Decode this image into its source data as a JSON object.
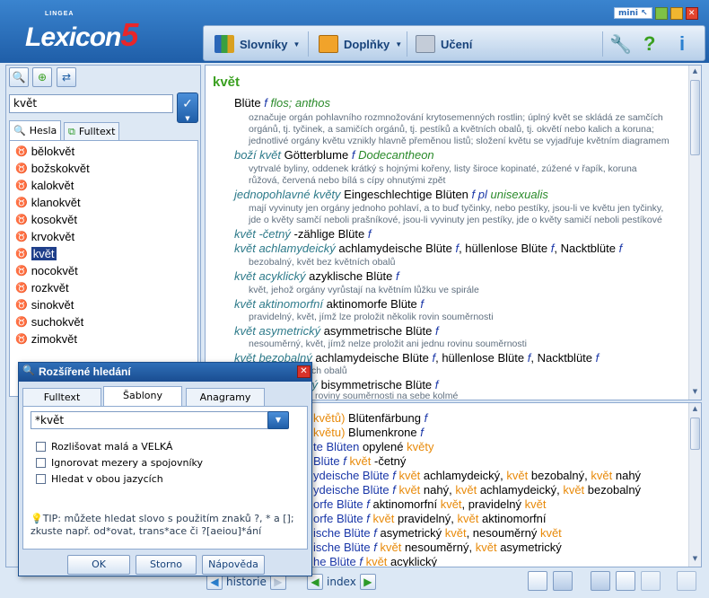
{
  "app": {
    "logo_brand": "Lexicon",
    "logo_version": "5",
    "logo_sup": "LINGEA",
    "mini_label": "mini"
  },
  "toolbar": {
    "dictionaries": "Slovníky",
    "addons": "Doplňky",
    "learning": "Učení"
  },
  "search": {
    "value": "květ"
  },
  "left_tabs": {
    "entries": "Hesla",
    "fulltext": "Fulltext"
  },
  "wordlist": [
    "bělokvět",
    "božskokvět",
    "kalokvět",
    "klanokvět",
    "kosokvět",
    "krvokvět",
    "květ",
    "nocokvět",
    "rozkvět",
    "sinokvět",
    "suchokvět",
    "zimokvět"
  ],
  "entry": {
    "headword": "květ",
    "l1": {
      "de": "Blüte",
      "g": "f",
      "lat": "flos; anthos"
    },
    "l1g": "označuje orgán pohlavního rozmnožování krytosemenných rostlin; úplný květ se skládá ze samčích",
    "l1g2": "orgánů, tj. tyčinek, a samičích orgánů, tj. pestíků a květních obalů, tj. okvětí nebo kalich a koruna;",
    "l1g3": "jednotlivé orgány květu vznikly hlavně přeměnou listů; složení květu se vyjadřuje květním diagramem",
    "l2": {
      "cz": "boží květ",
      "de": "Götterblume",
      "g": "f",
      "lat": "Dodecantheon"
    },
    "l2g": "vytrvalé byliny, oddenek krátký s hojnými kořeny, listy široce kopinaté, zúžené v řapík, koruna",
    "l2g2": "růžová, červená nebo bílá s cípy ohnutými zpět",
    "l3": {
      "cz": "jednopohlavné květy",
      "de": "Eingeschlechtige Blüten",
      "g": "f pl",
      "lat": "unisexualis"
    },
    "l3g": "mají vyvinuty jen orgány jednoho pohlaví, a to buď tyčinky, nebo pestíky, jsou-li ve květu jen tyčinky,",
    "l3g2": "jde o květy samčí neboli prašníkové, jsou-li vyvinuty jen pestíky, jde o květy samičí neboli pestíkové",
    "l4": {
      "cz": "květ -četný",
      "de": "-zählige Blüte",
      "g": "f"
    },
    "l5": {
      "cz": "květ achlamydeický",
      "de": "achlamydeische Blüte",
      "g": "f",
      "de2": "hüllenlose Blüte",
      "de3": "Nacktblüte"
    },
    "l5g": "bezobalný, květ bez květních obalů",
    "l6": {
      "cz": "květ acyklický",
      "de": "azyklische Blüte",
      "g": "f"
    },
    "l6g": "květ, jehož orgány vyrůstají na květním lůžku ve spirále",
    "l7": {
      "cz": "květ aktinomorfní",
      "de": "aktinomorfe Blüte",
      "g": "f"
    },
    "l7g": "pravidelný, květ, jímž lze proložit několik rovin souměrnosti",
    "l8": {
      "cz": "květ asymetrický",
      "de": "asymmetrische Blüte",
      "g": "f"
    },
    "l8g": "nesouměrný, květ, jímž nelze proložit ani jednu rovinu souměrnosti",
    "l9": {
      "cz": "květ bezobalný",
      "de": "achlamydeische Blüte",
      "g": "f",
      "de2": "hüllenlose Blüte",
      "de3": "Nacktblüte"
    },
    "l9g": "květ bez květních obalů",
    "l10": {
      "cz": "ký",
      "de": "bisymmetrische Blüte",
      "g": "f"
    },
    "l10g": "roviny souměrnosti na sebe kolmé"
  },
  "lower": [
    {
      "a": "květů)",
      "b": "Blütenfärbung",
      "g": "f"
    },
    {
      "a": "květu)",
      "b": "Blumenkrone",
      "g": "f"
    },
    {
      "a": "te Blüten",
      "b": "opylené",
      "c": "květy"
    },
    {
      "a": "Blüte",
      "g": "f",
      "c": "květ",
      "d": "-četný"
    },
    {
      "a": "ydeische Blüte",
      "g": "f",
      "c": "květ",
      "d": "achlamydeický,",
      "e": "květ",
      "f": "bezobalný,",
      "h": "květ",
      "i": "nahý"
    },
    {
      "a": "ydeische Blüte",
      "g": "f",
      "c": "květ",
      "d": "nahý,",
      "e": "květ",
      "f": "achlamydeický,",
      "h": "květ",
      "i": "bezobalný"
    },
    {
      "a": "orfe Blüte",
      "g": "f",
      "b": "aktinomorfní",
      "c": "květ",
      "d": ", pravidelný",
      "e": "květ"
    },
    {
      "a": "orfe Blüte",
      "g": "f",
      "c": "květ",
      "d": "pravidelný,",
      "e": "květ",
      "f": "aktinomorfní"
    },
    {
      "a": "ische Blüte",
      "g": "f",
      "b": "asymetrický",
      "c": "květ",
      "d": ", nesouměrný",
      "e": "květ"
    },
    {
      "a": "ische Blüte",
      "g": "f",
      "c": "květ",
      "d": "nesouměrný,",
      "e": "květ",
      "f": "asymetrický"
    },
    {
      "a": "he Blüte",
      "g": "f",
      "c": "květ",
      "d": "acyklický"
    }
  ],
  "bottom": {
    "history": "historie",
    "index": "index"
  },
  "dialog": {
    "title": "Rozšířené hledání",
    "tabs": [
      "Fulltext",
      "Šablony",
      "Anagramy"
    ],
    "input": "*květ",
    "opt1": "Rozlišovat malá a VELKÁ",
    "opt2": "Ignorovat mezery a spojovníky",
    "opt3": "Hledat v obou jazycích",
    "tip": "TIP: můžete hledat slovo s použitím znaků ?, * a []; zkuste např. od*ovat, trans*ace či ?[aeiou]*ání",
    "ok": "OK",
    "cancel": "Storno",
    "help": "Nápověda"
  },
  "colors": {
    "headword": "#3aa020",
    "accent": "#1f5ea8",
    "orange": "#e88a0a"
  }
}
